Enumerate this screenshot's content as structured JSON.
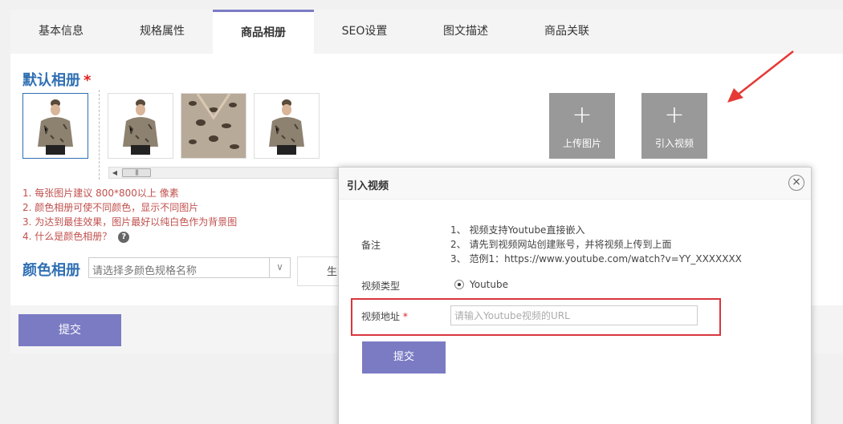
{
  "tabs": [
    {
      "label": "基本信息"
    },
    {
      "label": "规格属性"
    },
    {
      "label": "商品相册"
    },
    {
      "label": "SEO设置"
    },
    {
      "label": "图文描述"
    },
    {
      "label": "商品关联"
    }
  ],
  "gallery": {
    "title": "默认相册",
    "required_mark": "*",
    "upload_image_label": "上传图片",
    "import_video_label": "引入视频",
    "plus": "+",
    "tips": [
      "1. 每张图片建议 800*800以上 像素",
      "2. 颜色相册可使不同颜色，显示不同图片",
      "3. 为达到最佳效果，图片最好以纯白色作为背景图",
      "4. 什么是颜色相册？"
    ],
    "help": "?"
  },
  "color_album": {
    "title": "颜色相册",
    "select_placeholder": "请选择多颜色规格名称",
    "generate_label": "生"
  },
  "main_submit_label": "提交",
  "modal": {
    "title": "引入视频",
    "close": "×",
    "note_label": "备注",
    "notes": [
      "1、 视频支持Youtube直接嵌入",
      "2、 请先到视频网站创建账号，并将视频上传到上面",
      "3、 范例1：https://www.youtube.com/watch?v=YY_XXXXXXX"
    ],
    "video_type_label": "视频类型",
    "video_type_value": "Youtube",
    "video_url_label": "视频地址",
    "required_mark": "*",
    "url_placeholder": "请输入Youtube视频的URL",
    "submit_label": "提交"
  },
  "colors": {
    "accent": "#7b7bc4",
    "title_blue": "#2f6fb3",
    "tip_red": "#c0504d",
    "highlight_red": "#d9363e"
  }
}
